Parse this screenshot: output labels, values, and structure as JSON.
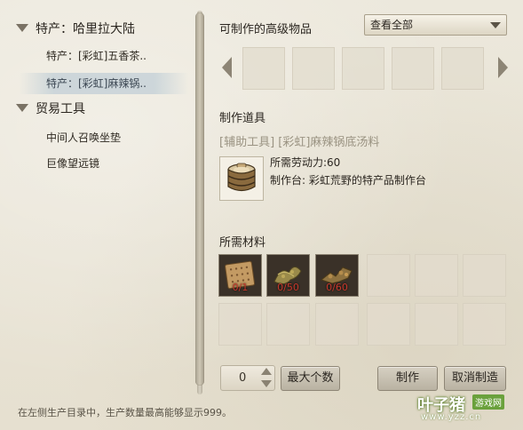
{
  "sidebar": {
    "groups": [
      {
        "label": "特产：哈里拉大陆",
        "items": [
          "特产：[彩虹]五香茶..",
          "特产：[彩虹]麻辣锅.."
        ]
      },
      {
        "label": "贸易工具",
        "items": [
          "中间人召唤坐垫",
          "巨像望远镜"
        ]
      }
    ],
    "selected_item": "特产：[彩虹]麻辣锅.."
  },
  "advanced": {
    "title": "可制作的高级物品",
    "filter_value": "查看全部"
  },
  "tool": {
    "title": "制作道具",
    "name": "[辅助工具] [彩虹]麻辣锅底汤料",
    "labor_line": "所需劳动力:60",
    "station_line": "制作台: 彩虹荒野的特产品制作台",
    "icon": "barrel-icon"
  },
  "materials": {
    "title": "所需材料",
    "filled": [
      {
        "icon": "cracker-icon",
        "count": "0/1"
      },
      {
        "icon": "herb-icon",
        "count": "0/50"
      },
      {
        "icon": "spice-icon",
        "count": "0/60"
      }
    ]
  },
  "actions": {
    "quantity": "0",
    "max_label": "最大个数",
    "craft_label": "制作",
    "cancel_label": "取消制造"
  },
  "footer": {
    "hint": "在左侧生产目录中，生产数量最高能够显示999。"
  },
  "watermark": {
    "main": "叶子猪",
    "tag": "游戏网",
    "url": "www.yzz.cn"
  },
  "colors": {
    "negative_count": "#c9392c",
    "selected_row": "#b0c4d2"
  }
}
